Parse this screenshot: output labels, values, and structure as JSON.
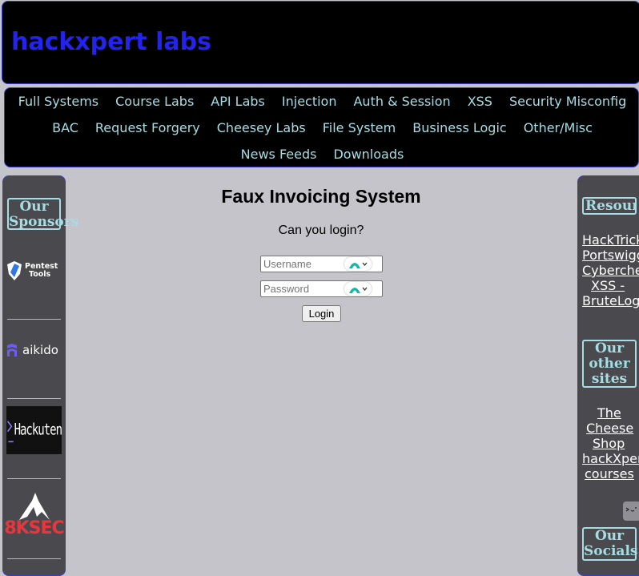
{
  "header": {
    "site_title": "hackxpert labs"
  },
  "nav": {
    "row1": [
      "Full Systems",
      "Course Labs",
      "API Labs",
      "Injection",
      "Auth & Session",
      "XSS",
      "Security Misconfig"
    ],
    "row2": [
      "BAC",
      "Request Forgery",
      "Cheesey Labs",
      "File System",
      "Business Logic",
      "Other/Misc"
    ],
    "row3": [
      "News Feeds",
      "Downloads"
    ]
  },
  "left_sidebar": {
    "heading_line1": "Our",
    "heading_line2": "Sponsors",
    "sponsors": {
      "pentest_line1": "Pentest",
      "pentest_line2": "Tools",
      "aikido": "aikido",
      "hackuten": "Hackuten",
      "eightksec": "8KSEC"
    }
  },
  "main": {
    "title": "Faux Invoicing System",
    "prompt": "Can you login?",
    "username_placeholder": "Username",
    "password_placeholder": "Password",
    "login_label": "Login"
  },
  "right_sidebar": {
    "resources_heading": "Resources",
    "resource_links": [
      "HackTricks",
      "Portswigger",
      "Cyberchef",
      "XSS -",
      "BruteLogic"
    ],
    "other_sites_heading_line1": "Our",
    "other_sites_heading_line2": "other",
    "other_sites_heading_line3": "sites",
    "other_sites_links": [
      "The",
      "Cheese",
      "Shop",
      "hackXpert",
      "courses"
    ],
    "socials_heading_line1": "Our",
    "socials_heading_line2": "Socials"
  },
  "colors": {
    "background": "#c5c4ca",
    "panel": "#000000",
    "sidebar": "#4a4a4e",
    "title_blue": "#2323ee",
    "nav_text": "#a6dde4",
    "border_blue": "#3c3cc8"
  }
}
